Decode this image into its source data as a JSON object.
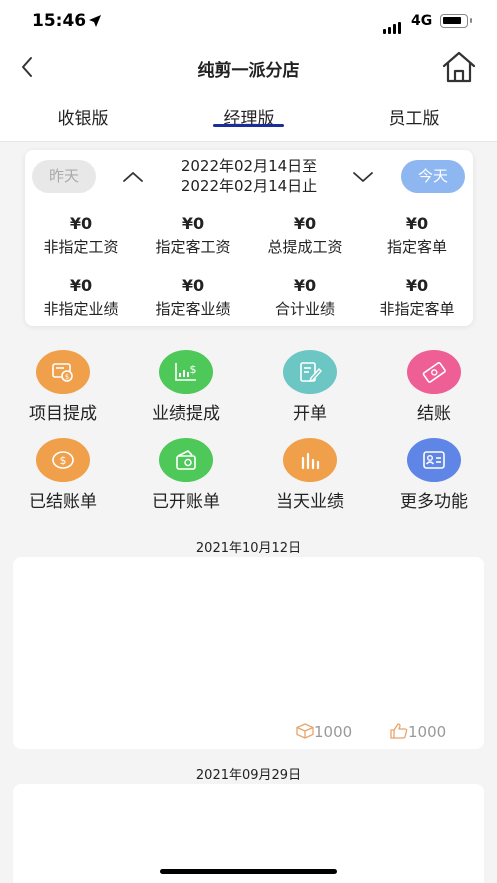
{
  "status_bar": {
    "time": "15:46",
    "network": "4G"
  },
  "nav": {
    "title": "纯剪一派分店"
  },
  "tabs": [
    {
      "label": "收银版"
    },
    {
      "label": "经理版",
      "active": true
    },
    {
      "label": "员工版"
    }
  ],
  "date_card": {
    "yesterday_label": "昨天",
    "today_label": "今天",
    "range_line1": "2022年02月14日至",
    "range_line2": "2022年02月14日止",
    "stats": [
      {
        "value": "¥0",
        "label": "非指定工资"
      },
      {
        "value": "¥0",
        "label": "指定客工资"
      },
      {
        "value": "¥0",
        "label": "总提成工资"
      },
      {
        "value": "¥0",
        "label": "指定客单"
      },
      {
        "value": "¥0",
        "label": "非指定业绩"
      },
      {
        "value": "¥0",
        "label": "指定客业绩"
      },
      {
        "value": "¥0",
        "label": "合计业绩"
      },
      {
        "value": "¥0",
        "label": "非指定客单"
      }
    ]
  },
  "functions": [
    {
      "label": "项目提成",
      "icon": "project-commission-icon",
      "color": "#f0a04b"
    },
    {
      "label": "业绩提成",
      "icon": "performance-commission-icon",
      "color": "#4fc85a"
    },
    {
      "label": "开单",
      "icon": "open-order-icon",
      "color": "#6cc6c4"
    },
    {
      "label": "结账",
      "icon": "checkout-icon",
      "color": "#ee5f96"
    },
    {
      "label": "已结账单",
      "icon": "settled-bills-icon",
      "color": "#f0a04b"
    },
    {
      "label": "已开账单",
      "icon": "opened-bills-icon",
      "color": "#4fc85a"
    },
    {
      "label": "当天业绩",
      "icon": "daily-performance-icon",
      "color": "#f0a04b"
    },
    {
      "label": "更多功能",
      "icon": "more-functions-icon",
      "color": "#5f86e6"
    }
  ],
  "records": [
    {
      "date": "2021年10月12日",
      "box_count": "1000",
      "like_count": "1000"
    },
    {
      "date": "2021年09月29日"
    }
  ],
  "colors": {
    "accent": "#1b2c9c",
    "today_button": "#8eb6f0",
    "record_icon": "#e8a56a"
  }
}
